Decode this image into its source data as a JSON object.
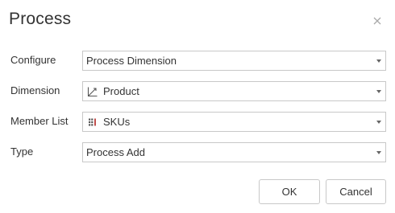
{
  "dialog": {
    "title": "Process",
    "close_icon": "close-icon"
  },
  "fields": [
    {
      "label": "Configure",
      "value": "Process Dimension",
      "icon": null
    },
    {
      "label": "Dimension",
      "value": "Product",
      "icon": "dimension-axis-icon"
    },
    {
      "label": "Member List",
      "value": "SKUs",
      "icon": "member-list-grid-icon"
    },
    {
      "label": "Type",
      "value": "Process Add",
      "icon": null
    }
  ],
  "buttons": {
    "ok_label": "OK",
    "cancel_label": "Cancel"
  },
  "colors": {
    "border": "#c8c8c8",
    "text": "#333333",
    "icon_accent": "#c0504d"
  }
}
